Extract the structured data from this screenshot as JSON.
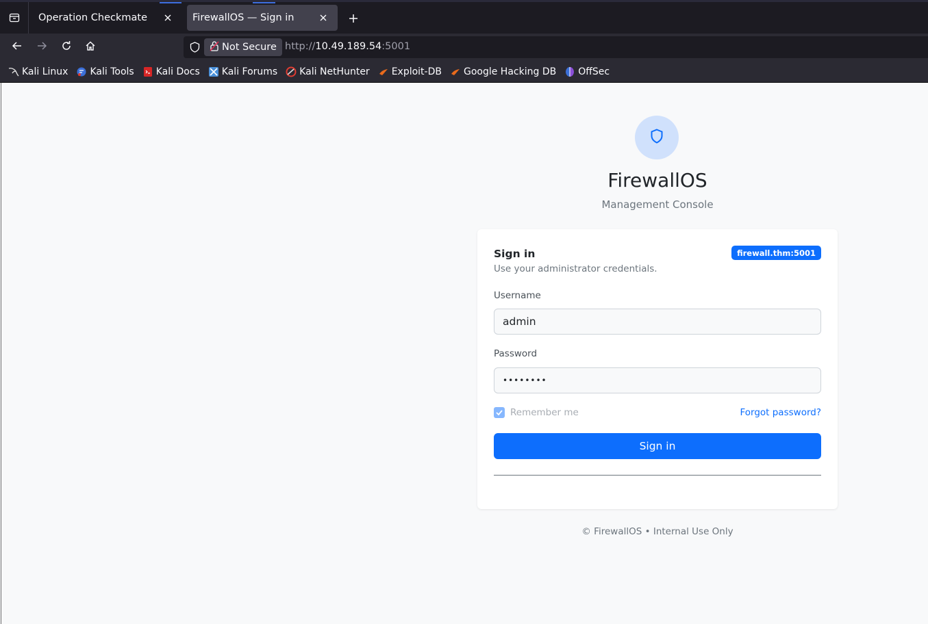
{
  "browser": {
    "tabs": [
      {
        "title": "Operation Checkmate",
        "active": false
      },
      {
        "title": "FirewallOS — Sign in",
        "active": true
      }
    ],
    "url": {
      "security_label": "Not Secure",
      "scheme": "http://",
      "host": "10.49.189.54",
      "port": ":5001"
    },
    "bookmarks": [
      {
        "label": "Kali Linux",
        "icon": "kali-dragon-icon"
      },
      {
        "label": "Kali Tools",
        "icon": "kali-tools-icon"
      },
      {
        "label": "Kali Docs",
        "icon": "kali-docs-icon"
      },
      {
        "label": "Kali Forums",
        "icon": "kali-forums-icon"
      },
      {
        "label": "Kali NetHunter",
        "icon": "kali-nethunter-icon"
      },
      {
        "label": "Exploit-DB",
        "icon": "exploit-db-icon"
      },
      {
        "label": "Google Hacking DB",
        "icon": "ghdb-icon"
      },
      {
        "label": "OffSec",
        "icon": "offsec-icon"
      }
    ]
  },
  "page": {
    "brand": "FirewallOS",
    "subtitle": "Management Console",
    "card": {
      "title": "Sign in",
      "description": "Use your administrator credentials.",
      "host_badge": "firewall.thm:5001",
      "username_label": "Username",
      "username_value": "admin",
      "password_label": "Password",
      "password_value": "••••••••",
      "remember_label": "Remember me",
      "remember_checked": true,
      "forgot_label": "Forgot password?",
      "submit_label": "Sign in"
    },
    "footer": "© FirewallOS • Internal Use Only"
  },
  "colors": {
    "accent": "#0d6efd",
    "logo_bg": "#d0e1fc",
    "chrome_dark": "#1c1b22",
    "chrome": "#2b2a33"
  }
}
